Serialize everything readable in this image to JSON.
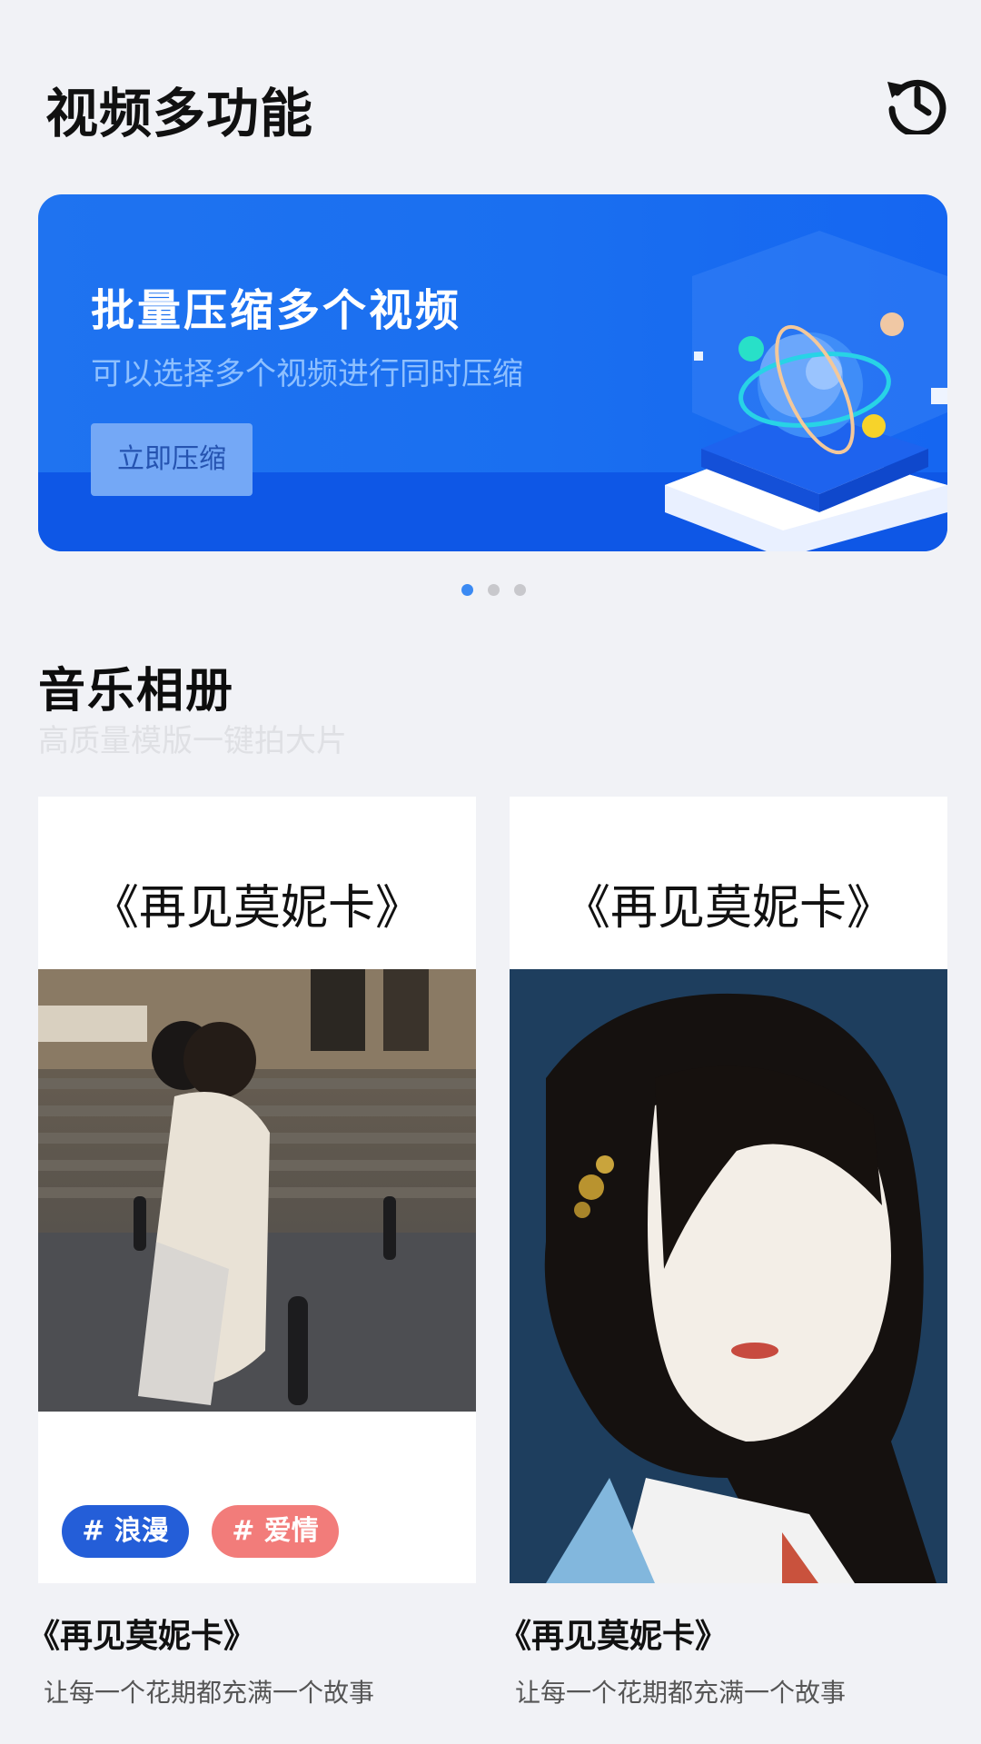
{
  "header": {
    "title": "视频多功能",
    "history_icon": "history-clock-icon"
  },
  "banner": {
    "title": "批量压缩多个视频",
    "subtitle": "可以选择多个视频进行同时压缩",
    "button_label": "立即压缩",
    "colors": {
      "bg": "#1f73f0",
      "button": "#74a8f6"
    },
    "pager": {
      "total": 3,
      "active": 1
    }
  },
  "section": {
    "title": "音乐相册",
    "subtitle": "高质量模版一键拍大片"
  },
  "cards": [
    {
      "heading": "《再见莫妮卡》",
      "tags": [
        "# 浪漫",
        "# 爱情"
      ],
      "caption": "《再见莫妮卡》",
      "description": "让每一个花期都充满一个故事"
    },
    {
      "heading": "《再见莫妮卡》",
      "caption": "《再见莫妮卡》",
      "description": "让每一个花期都充满一个故事"
    }
  ]
}
